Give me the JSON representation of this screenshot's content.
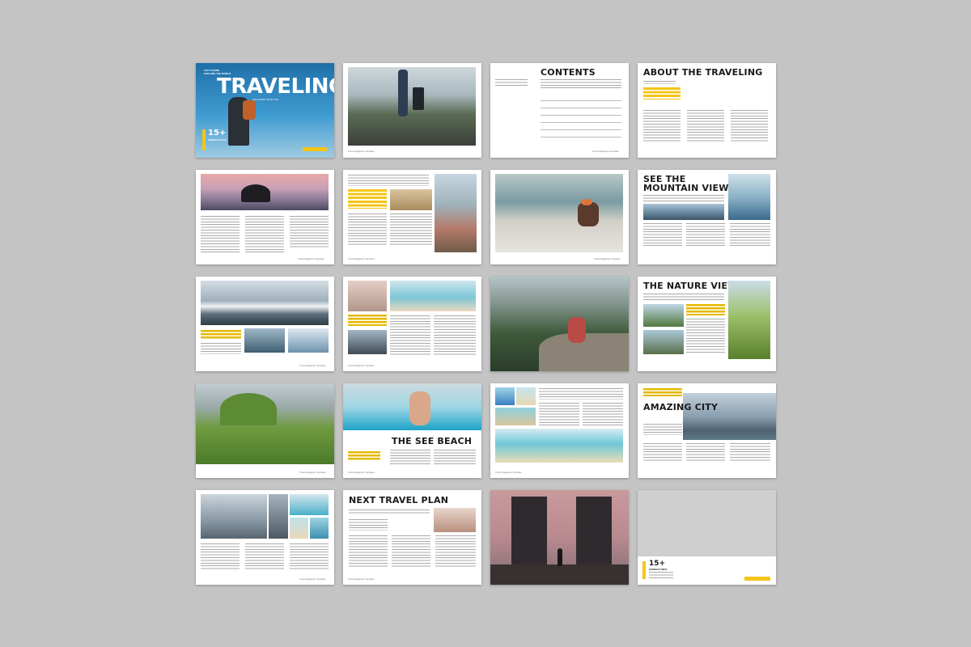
{
  "cover": {
    "tag_lines": [
      "LET'S GOING",
      "EXPLORE THE WORLD"
    ],
    "title": "TRAVELING",
    "subtitle": "MAGAZINE TEMPLATE",
    "badge_number": "15+",
    "badge_label": "UNIQUE PLACE"
  },
  "headings": {
    "contents": "CONTENTS",
    "about": "ABOUT THE TRAVELING",
    "mountain_line1": "SEE THE",
    "mountain_line2": "MOUNTAIN VIEW",
    "nature": "THE NATURE VIEW",
    "beach": "THE SEE BEACH",
    "city": "AMAZING CITY",
    "next_plan": "NEXT TRAVEL PLAN",
    "contact_number": "15+",
    "contact_label": "CONTACT INFO"
  },
  "contents_rows": [
    "",
    "",
    "",
    "",
    "",
    ""
  ],
  "footer": "Travel Magazine Template",
  "colors": {
    "background": "#c4c4c4",
    "page": "#ffffff",
    "accent": "#f5c518",
    "cover_blue": "#2e88c0"
  }
}
